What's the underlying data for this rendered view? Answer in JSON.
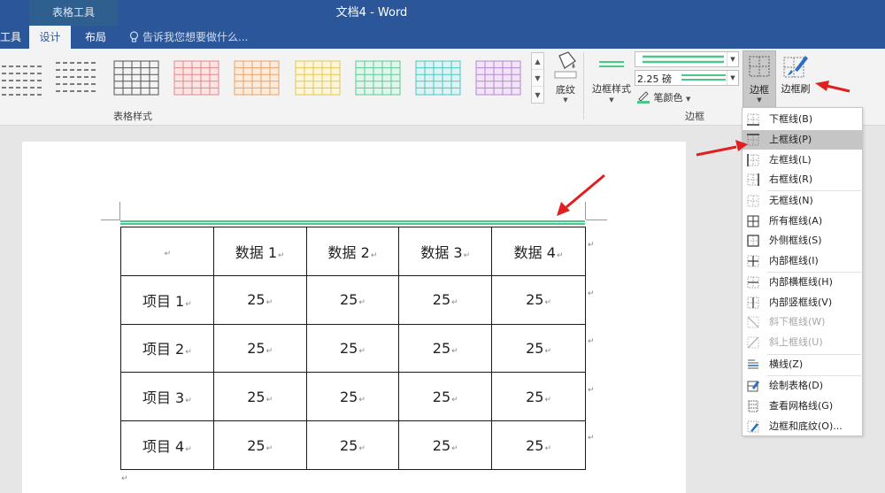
{
  "titlebar": {
    "context_group": "表格工具",
    "doc_title": "文档4 - Word",
    "tabs": {
      "tool": "工具",
      "design": "设计",
      "layout": "布局"
    },
    "tell_me": "告诉我您想要做什么..."
  },
  "ribbon": {
    "table_styles_group": "表格样式",
    "shading_label": "底纹",
    "border_styles_label": "边框样式",
    "line_weight": "2.25 磅",
    "pen_color_label": "笔颜色",
    "borders_group": "边框",
    "borders_button": "边框",
    "border_painter_button": "边框刷"
  },
  "table": {
    "headers": [
      "",
      "数据 1",
      "数据 2",
      "数据 3",
      "数据 4"
    ],
    "rows": [
      [
        "项目 1",
        "25",
        "25",
        "25",
        "25"
      ],
      [
        "项目 2",
        "25",
        "25",
        "25",
        "25"
      ],
      [
        "项目 3",
        "25",
        "25",
        "25",
        "25"
      ],
      [
        "项目 4",
        "25",
        "25",
        "25",
        "25"
      ]
    ]
  },
  "borders_menu": {
    "items": [
      {
        "label": "下框线(B)"
      },
      {
        "label": "上框线(P)"
      },
      {
        "label": "左框线(L)"
      },
      {
        "label": "右框线(R)"
      },
      {
        "label": "无框线(N)"
      },
      {
        "label": "所有框线(A)"
      },
      {
        "label": "外侧框线(S)"
      },
      {
        "label": "内部框线(I)"
      },
      {
        "label": "内部横框线(H)"
      },
      {
        "label": "内部竖框线(V)"
      },
      {
        "label": "斜下框线(W)"
      },
      {
        "label": "斜上框线(U)"
      },
      {
        "label": "横线(Z)"
      },
      {
        "label": "绘制表格(D)"
      },
      {
        "label": "查看网格线(G)"
      },
      {
        "label": "边框和底纹(O)..."
      }
    ]
  },
  "colors": {
    "ribbon_blue": "#2b579a",
    "border_green": "#4cc78a",
    "arrow_red": "#e02020"
  }
}
